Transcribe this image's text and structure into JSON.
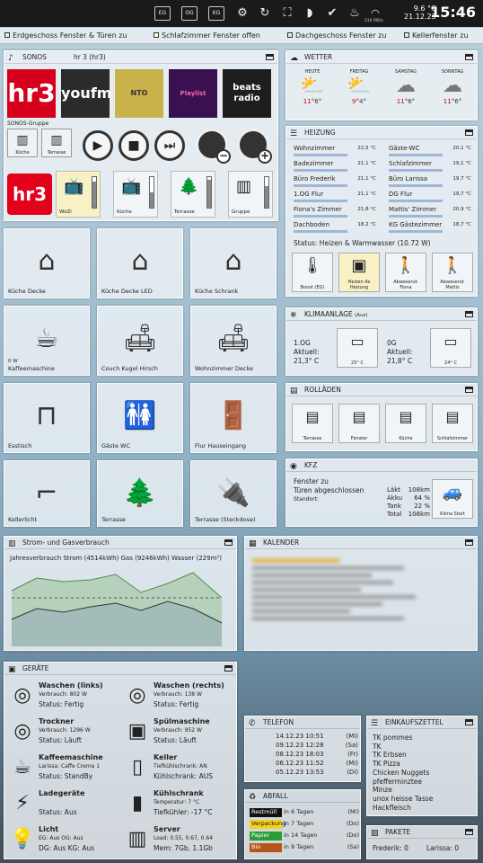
{
  "topbar": {
    "buttons": [
      "EG",
      "OG",
      "KG"
    ],
    "outdoor_temp": "9.6 °C",
    "date": "21.12.23",
    "time": "15:46",
    "wifi_speed": "516 MB/s"
  },
  "strip": [
    "Erdgeschoss Fenster & Türen zu",
    "Schlafzimmer Fenster offen",
    "Dachgeschoss Fenster zu",
    "Kellerfenster zu"
  ],
  "sonos": {
    "title": "SONOS",
    "now_playing": "hr 3 (hr3)",
    "group_label": "SONOS-Gruppe",
    "stations": [
      "hr3",
      "youfm",
      "NTO",
      "Playlist",
      "beats radio"
    ],
    "group_buttons": [
      "Küche",
      "Terrasse"
    ],
    "zone_logo": "hr3",
    "zones": [
      {
        "label": "WoZi",
        "level": 0.85
      },
      {
        "label": "Küche",
        "level": 0.5
      },
      {
        "label": "Terrasse",
        "level": 0.9
      },
      {
        "label": "Gruppe",
        "level": 0.7
      }
    ]
  },
  "tiles": [
    {
      "label": "Küche Decke"
    },
    {
      "label": "Küche Decke LED"
    },
    {
      "label": "Küche Schrank"
    },
    {
      "label": "Kaffeemaschine",
      "sub": "0 W"
    },
    {
      "label": "Couch Kugel Hirsch"
    },
    {
      "label": "Wohnzimmer Decke"
    },
    {
      "label": "Esstisch"
    },
    {
      "label": "Gäste WC"
    },
    {
      "label": "Flur Hauseingang"
    },
    {
      "label": "Kellerlicht"
    },
    {
      "label": "Terrasse"
    },
    {
      "label": "Terrasse (Steckdose)"
    }
  ],
  "weather": {
    "title": "WETTER",
    "days": [
      {
        "day": "HEUTE",
        "hi": "11°",
        "lo": "6°"
      },
      {
        "day": "FREITAG",
        "hi": "9°",
        "lo": "4°"
      },
      {
        "day": "SAMSTAG",
        "hi": "11°",
        "lo": "6°"
      },
      {
        "day": "SONNTAG",
        "hi": "11°",
        "lo": "6°"
      }
    ]
  },
  "heating": {
    "title": "HEIZUNG",
    "rooms": [
      {
        "name": "Wohnzimmer",
        "value": "22,5 °C"
      },
      {
        "name": "Gäste-WC",
        "value": "20,1 °C"
      },
      {
        "name": "Badezimmer",
        "value": "21,1 °C"
      },
      {
        "name": "Schlafzimmer",
        "value": "19,1 °C"
      },
      {
        "name": "Büro Frederik",
        "value": "21,1 °C"
      },
      {
        "name": "Büro Larissa",
        "value": "19,7 °C"
      },
      {
        "name": "1.OG Flur",
        "value": "21,1 °C"
      },
      {
        "name": "DG Flur",
        "value": "19,7 °C"
      },
      {
        "name": "Fiona's Zimmer",
        "value": "21,8 °C"
      },
      {
        "name": "Mattis' Zimmer",
        "value": "20,9 °C"
      },
      {
        "name": "Dachboden",
        "value": "18,2 °C"
      },
      {
        "name": "KG Gästezimmer",
        "value": "18,7 °C"
      }
    ],
    "status": "Status: Heizen & Warmwasser (10.72 W)",
    "buttons": [
      {
        "label": "Boost (EG)"
      },
      {
        "label": "Heizen As Heizung"
      },
      {
        "label": "Abwesend: Fiona"
      },
      {
        "label": "Abwesend: Mattis"
      }
    ]
  },
  "klima": {
    "title": "KLIMAANLAGE",
    "state": "(Aus)",
    "units": [
      {
        "name": "1.OG",
        "actual_label": "Aktuell:",
        "actual": "21,3° C",
        "set": "25° C"
      },
      {
        "name": "0G",
        "actual_label": "Aktuell:",
        "actual": "21,8° C",
        "set": "24° C"
      }
    ]
  },
  "rolladen": {
    "title": "ROLLÄDEN",
    "items": [
      "Terrasse",
      "Fenster",
      "Küche",
      "Schlafzimmer"
    ]
  },
  "kfz": {
    "title": "KFZ",
    "status1": "Fenster zu",
    "status2": "Türen abgeschlossen",
    "location_label": "Standort:",
    "rows": [
      {
        "k": "Läkt",
        "v": "108km"
      },
      {
        "k": "Akku",
        "v": "64 %"
      },
      {
        "k": "Tank",
        "v": "22 %"
      },
      {
        "k": "Total",
        "v": "108km"
      }
    ],
    "button": "Klima Start"
  },
  "energy": {
    "title": "Strom- und Gasverbrauch",
    "subtitle": "Jahresverbrauch Strom (4514kWh) Gas (9246kWh) Wasser (229m³)"
  },
  "calendar": {
    "title": "KALENDER"
  },
  "devices": {
    "title": "GERÄTE",
    "items": [
      {
        "title": "Waschen (links)",
        "l1": "Verbrauch: 802 W",
        "l2": "Status: Fertig",
        "icon": "washer-icon"
      },
      {
        "title": "Waschen (rechts)",
        "l1": "Verbrauch: 138 W",
        "l2": "Status: Fertig",
        "icon": "washer-icon"
      },
      {
        "title": "Trockner",
        "l1": "Verbrauch: 1296 W",
        "l2": "Status: Läuft",
        "icon": "dryer-icon"
      },
      {
        "title": "Spülmaschine",
        "l1": "Verbrauch: 952 W",
        "l2": "Status: Läuft",
        "icon": "dishwasher-icon"
      },
      {
        "title": "Kaffeemaschine",
        "l1": "Larissa: Caffe Crema 1",
        "l2": "Status: StandBy",
        "icon": "coffee-machine-icon"
      },
      {
        "title": "Keller",
        "l1": "Tiefkühlschrank: AN",
        "l2": "Kühlschrank: AUS",
        "icon": "freezer-icon"
      },
      {
        "title": "Ladegeräte",
        "l1": "",
        "l2": "Status: Aus",
        "icon": "charger-icon"
      },
      {
        "title": "Kühlschrank",
        "l1": "Temperatur: 7 °C",
        "l2": "Tiefkühler: -17 °C",
        "icon": "fridge-icon"
      },
      {
        "title": "Licht",
        "l1": "EG: Aus OG: Aus",
        "l2": "DG: Aus KG: Aus",
        "icon": "bulb-icon"
      },
      {
        "title": "Server",
        "l1": "Load: 0.55, 0.67, 0.64",
        "l2": "Mem: 7Gb, 1.1Gb",
        "icon": "server-icon"
      }
    ]
  },
  "telefon": {
    "title": "TELEFON",
    "calls": [
      {
        "date": "14.12.23 10:51",
        "day": "(Mi)"
      },
      {
        "date": "09.12.23 12:28",
        "day": "(Sa)"
      },
      {
        "date": "08.12.23 18:03",
        "day": "(Fr)"
      },
      {
        "date": "06.12.23 11:52",
        "day": "(Mi)"
      },
      {
        "date": "05.12.23 13:53",
        "day": "(Di)"
      }
    ]
  },
  "abfall": {
    "title": "ABFALL",
    "rows": [
      {
        "name": "Restmüll",
        "when": "in 6 Tagen",
        "day": "(Mi)",
        "color": "#111111",
        "text": "#ffffff"
      },
      {
        "name": "Verpackung",
        "when": "in 7 Tagen",
        "day": "(Do)",
        "color": "#f2d21b",
        "text": "#111111"
      },
      {
        "name": "Papier",
        "when": "in 14 Tagen",
        "day": "(Do)",
        "color": "#2a9d3a",
        "text": "#ffffff"
      },
      {
        "name": "Bio",
        "when": "in 9 Tagen",
        "day": "(Sa)",
        "color": "#b5561b",
        "text": "#ffffff"
      }
    ]
  },
  "einkauf": {
    "title": "EINKAUFSZETTEL",
    "items": [
      "TK pommes",
      "TK",
      "TK Erbsen",
      "TK Pizza",
      "Chicken Nuggets",
      "pfefferminztee",
      "Minze",
      "unox heisse Tasse",
      "Hackfleisch"
    ]
  },
  "pakete": {
    "title": "PAKETE",
    "frederik": "Frederik: 0",
    "larissa": "Larissa: 0"
  },
  "colors": {
    "accent": "#3a6fa0",
    "heat_bar": "#9fb7d7"
  }
}
